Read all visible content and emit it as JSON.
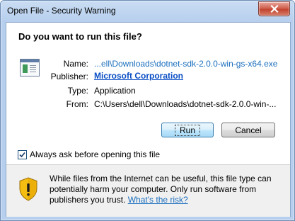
{
  "window": {
    "title": "Open File - Security Warning",
    "close_icon": "close-icon"
  },
  "dialog": {
    "question": "Do you want to run this file?",
    "file_icon": "executable-file-icon",
    "fields": {
      "name_label": "Name:",
      "name_value": "...ell\\Downloads\\dotnet-sdk-2.0.0-win-gs-x64.exe",
      "publisher_label": "Publisher:",
      "publisher_value": "Microsoft Corporation",
      "type_label": "Type:",
      "type_value": "Application",
      "from_label": "From:",
      "from_value": "C:\\Users\\dell\\Downloads\\dotnet-sdk-2.0.0-win-..."
    },
    "buttons": {
      "run_label": "Run",
      "cancel_label": "Cancel"
    },
    "checkbox": {
      "label": "Always ask before opening this file",
      "checked": true
    }
  },
  "warning": {
    "icon": "warning-shield-icon",
    "text": "While files from the Internet can be useful, this file type can potentially harm your computer. Only run software from publishers you trust.",
    "link_label": "What's the risk?"
  },
  "colors": {
    "link": "#1c6fbe",
    "publisher_link": "#0a4ec4",
    "title_bar": "#b7cfee",
    "close_button": "#c2432f",
    "shield": "#f0b400"
  }
}
